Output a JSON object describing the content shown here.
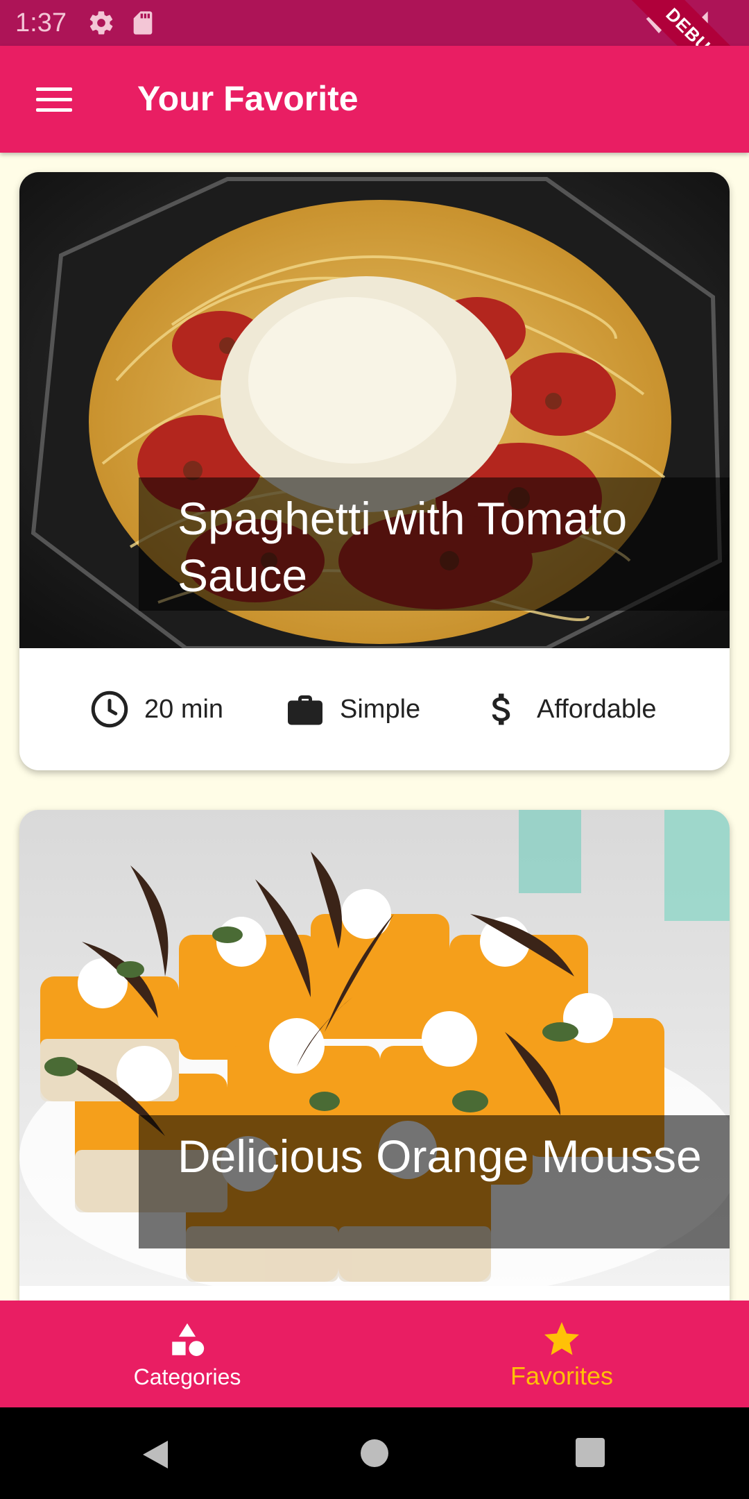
{
  "status_bar": {
    "time": "1:37",
    "debug_label": "DEBUG"
  },
  "app_bar": {
    "title": "Your Favorite"
  },
  "meals": [
    {
      "title": "Spaghetti with Tomato Sauce",
      "duration": "20 min",
      "complexity": "Simple",
      "affordability": "Affordable"
    },
    {
      "title": "Delicious Orange Mousse"
    }
  ],
  "bottom_nav": {
    "categories_label": "Categories",
    "favorites_label": "Favorites",
    "active": "Favorites",
    "active_color": "#ffc107"
  },
  "colors": {
    "primary": "#e91e63",
    "status_bar": "#ad1457",
    "canvas": "#fffde7",
    "accent": "#ffc107"
  }
}
